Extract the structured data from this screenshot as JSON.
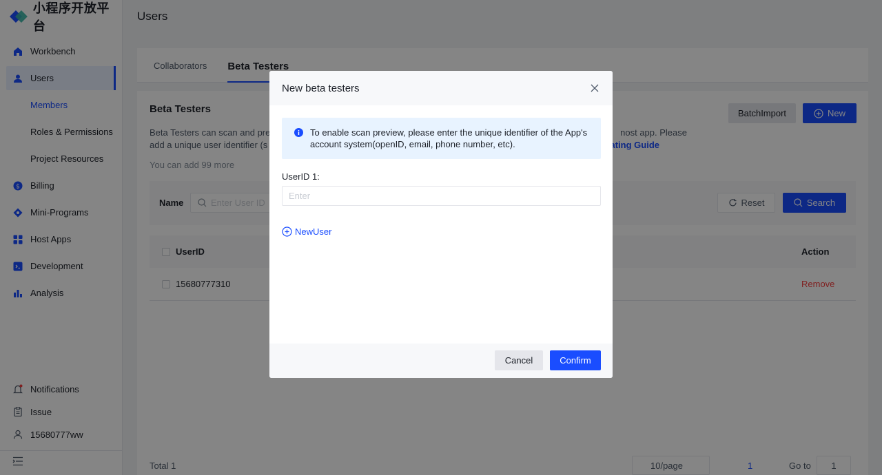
{
  "app": {
    "brand": "小程序开放平台",
    "page_title": "Users"
  },
  "sidebar": {
    "items": [
      {
        "label": "Workbench",
        "icon": "home-icon"
      },
      {
        "label": "Users",
        "icon": "user-icon"
      },
      {
        "label": "Members"
      },
      {
        "label": "Roles & Permissions"
      },
      {
        "label": "Project Resources"
      },
      {
        "label": "Billing",
        "icon": "billing-icon"
      },
      {
        "label": "Mini-Programs",
        "icon": "miniprogram-icon"
      },
      {
        "label": "Host Apps",
        "icon": "apps-icon"
      },
      {
        "label": "Development",
        "icon": "code-icon"
      },
      {
        "label": "Analysis",
        "icon": "chart-icon"
      }
    ],
    "bottom": [
      {
        "label": "Notifications",
        "icon": "bell-icon"
      },
      {
        "label": "Issue",
        "icon": "clipboard-icon"
      },
      {
        "label": "15680777ww",
        "icon": "person-icon"
      }
    ]
  },
  "tabs": [
    "Collaborators",
    "Beta Testers"
  ],
  "section": {
    "title": "Beta Testers",
    "desc_start": "Beta Testers can scan and pre",
    "desc_end": "nost app. Please",
    "desc_line2_start": "add a unique user identifier (s",
    "desc_link": "ating Guide",
    "remaining": "You can add 99 more",
    "batch_import": "BatchImport",
    "new": "New"
  },
  "filter": {
    "name_label": "Name",
    "placeholder": "Enter User ID",
    "reset": "Reset",
    "search": "Search"
  },
  "table": {
    "headers": {
      "userid": "UserID",
      "action": "Action"
    },
    "rows": [
      {
        "userid": "15680777310",
        "action": "Remove"
      }
    ]
  },
  "pagination": {
    "total": "Total 1",
    "size": "10/page",
    "page": "1",
    "goto": "Go to",
    "goto_value": "1"
  },
  "modal": {
    "title": "New beta testers",
    "info": "To enable scan preview, please enter the unique identifier of the App's account system(openID, email, phone number, etc).",
    "field_label": "UserID 1:",
    "field_placeholder": "Enter",
    "add_user": "NewUser",
    "cancel": "Cancel",
    "confirm": "Confirm"
  },
  "colors": {
    "primary": "#1a4dff",
    "danger": "#f53f3f",
    "overlay": "rgba(0,0,0,0.48)"
  }
}
